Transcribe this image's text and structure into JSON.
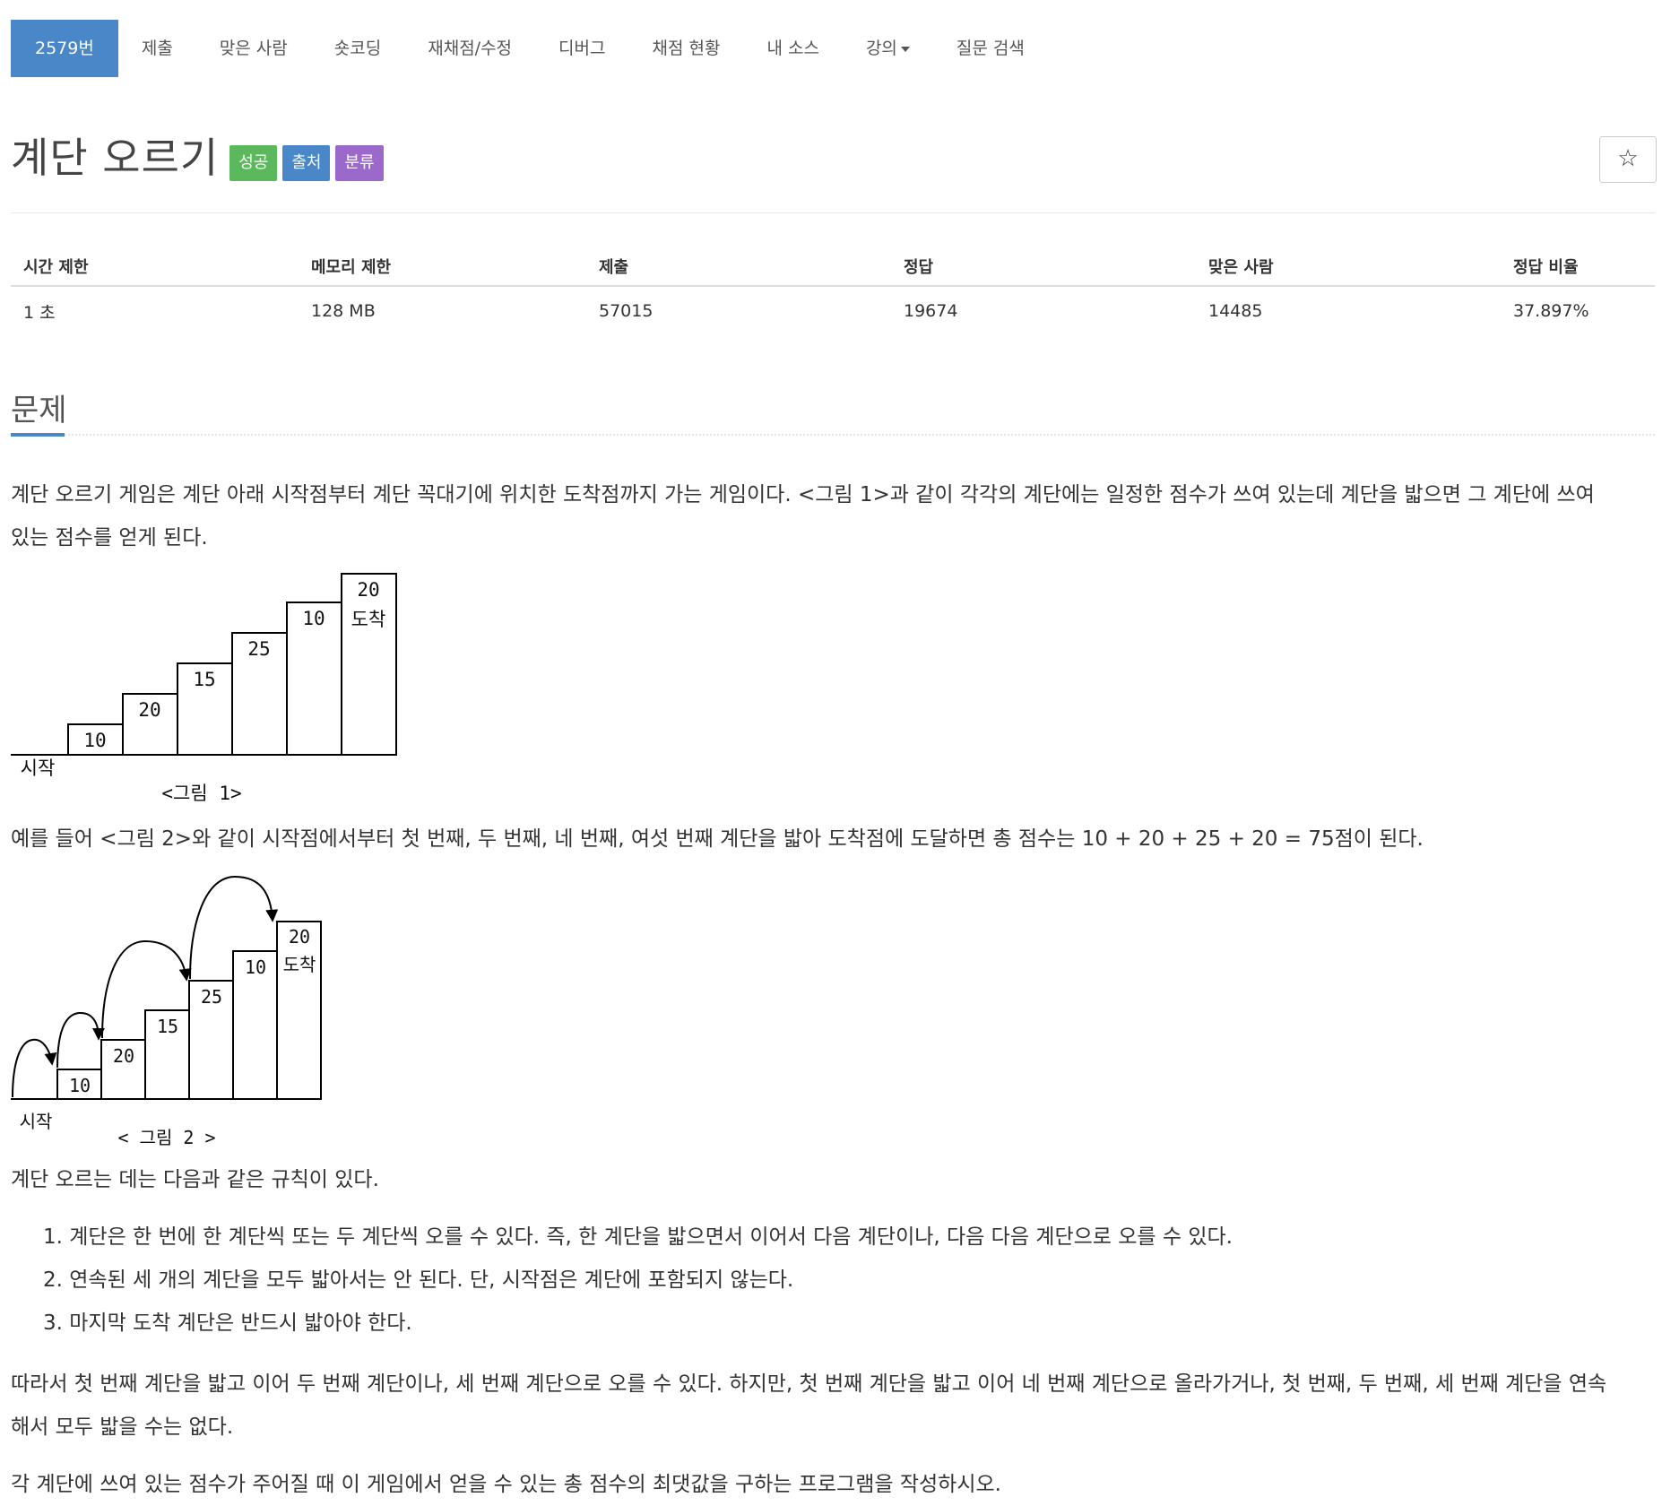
{
  "nav": {
    "items": [
      "2579번",
      "제출",
      "맞은 사람",
      "숏코딩",
      "재채점/수정",
      "디버그",
      "채점 현황",
      "내 소스",
      "강의",
      "질문 검색"
    ]
  },
  "problem": {
    "title": "계단 오르기",
    "labels": [
      {
        "text": "성공",
        "color": "#5cb85c"
      },
      {
        "text": "출처",
        "color": "#4a87c8"
      },
      {
        "text": "분류",
        "color": "#9b69c9"
      }
    ],
    "star": "☆"
  },
  "info_table": {
    "headers": [
      "시간 제한",
      "메모리 제한",
      "제출",
      "정답",
      "맞은 사람",
      "정답 비율"
    ],
    "values": [
      "1 초",
      "128 MB",
      "57015",
      "19674",
      "14485",
      "37.897%"
    ]
  },
  "section": {
    "title": "문제",
    "para1": "계단 오르기 게임은 계단 아래 시작점부터 계단 꼭대기에 위치한 도착점까지 가는 게임이다. <그림 1>과 같이 각각의 계단에는 일정한 점수가 쓰여 있는데 계단을 밟으면 그 계단에 쓰여 있는 점수를 얻게 된다.",
    "para1_line1": "계단 오르기 게임은 계단 아래 시작점부터 계단 꼭대기에 위치한 도착점까지 가는 게임이다. <그림 1>과 같이 각각의 계단에는 일정한 점수가 쓰여 있는데 계단을 밟으면 그 계단에 쓰여",
    "para1_line2": "있는 점수를 얻게 된다.",
    "para2": "예를 들어 <그림 2>와 같이 시작점에서부터 첫 번째, 두 번째, 네 번째, 여섯 번째 계단을 밟아 도착점에 도달하면 총 점수는 10 + 20 + 25 + 20 = 75점이 된다.",
    "para3": "계단 오르는 데는 다음과 같은 규칙이 있다.",
    "rules": [
      "1. 계단은 한 번에 한 계단씩 또는 두 계단씩 오를 수 있다. 즉, 한 계단을 밟으면서 이어서 다음 계단이나, 다음 다음 계단으로 오를 수 있다.",
      "2. 연속된 세 개의 계단을 모두 밟아서는 안 된다. 단, 시작점은 계단에 포함되지 않는다.",
      "3. 마지막 도착 계단은 반드시 밟아야 한다."
    ],
    "para4_line1": "따라서 첫 번째 계단을 밟고 이어 두 번째 계단이나, 세 번째 계단으로 오를 수 있다. 하지만, 첫 번째 계단을 밟고 이어 네 번째 계단으로 올라가거나, 첫 번째, 두 번째, 세 번째 계단을 연속",
    "para4_line2": "해서 모두 밟을 수는 없다.",
    "para5": "각 계단에 쓰여 있는 점수가 주어질 때 이 게임에서 얻을 수 있는 총 점수의 최댓값을 구하는 프로그램을 작성하시오."
  },
  "figure1": {
    "scores": [
      "10",
      "20",
      "15",
      "25",
      "10",
      "20"
    ],
    "finish_label": "도착",
    "start_label": "시작",
    "caption": "<그림 1>"
  },
  "figure2": {
    "scores": [
      "10",
      "20",
      "15",
      "25",
      "10",
      "20"
    ],
    "finish_label": "도착",
    "start_label": "시작",
    "caption": "< 그림 2 >"
  }
}
